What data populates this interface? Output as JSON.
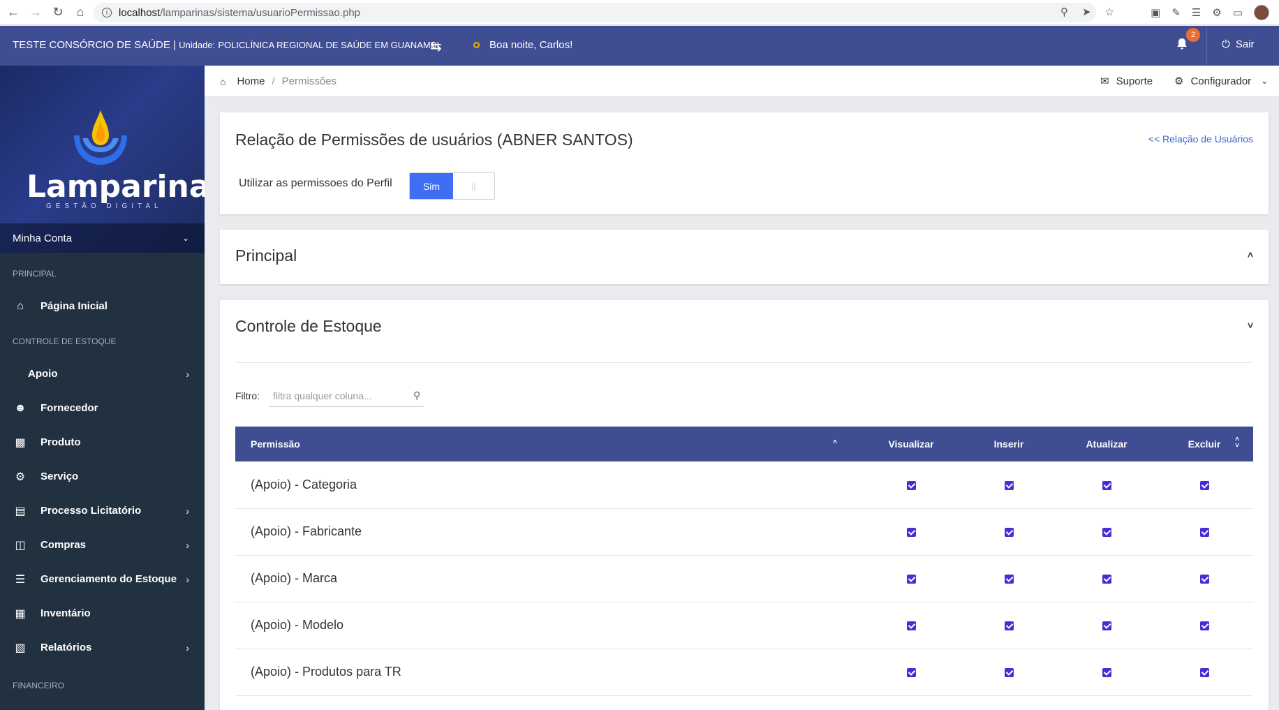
{
  "browser": {
    "url_host": "localhost",
    "url_path": "/lamparinas/sistema/usuarioPermissao.php"
  },
  "header": {
    "system_name": "TESTE CONSÓRCIO DE SAÚDE |",
    "unit_label": "Unidade:",
    "unit_value": "POLICLÍNICA REGIONAL DE SAÚDE EM GUANAMBI",
    "greeting": "Boa noite, Carlos!",
    "notification_count": "2",
    "logout_label": "Sair"
  },
  "sidebar": {
    "logo_text": "Lamparinas",
    "logo_subtitle": "GESTÃO DIGITAL",
    "account_label": "Minha Conta",
    "sections": [
      {
        "title": "PRINCIPAL",
        "items": [
          {
            "label": "Página Inicial",
            "icon": "home-icon",
            "has_submenu": false
          }
        ]
      },
      {
        "title": "CONTROLE DE ESTOQUE",
        "items": [
          {
            "label": "Apoio",
            "icon": "",
            "has_submenu": true
          },
          {
            "label": "Fornecedor",
            "icon": "user-icon",
            "has_submenu": false
          },
          {
            "label": "Produto",
            "icon": "gift-icon",
            "has_submenu": false
          },
          {
            "label": "Serviço",
            "icon": "gears-icon",
            "has_submenu": false
          },
          {
            "label": "Processo Licitatório",
            "icon": "document-icon",
            "has_submenu": true
          },
          {
            "label": "Compras",
            "icon": "bag-icon",
            "has_submenu": true
          },
          {
            "label": "Gerenciamento do Estoque",
            "icon": "layers-icon",
            "has_submenu": true
          },
          {
            "label": "Inventário",
            "icon": "clipboard-icon",
            "has_submenu": false
          },
          {
            "label": "Relatórios",
            "icon": "report-icon",
            "has_submenu": true
          }
        ]
      },
      {
        "title": "FINANCEIRO",
        "items": []
      }
    ]
  },
  "breadcrumb": {
    "home": "Home",
    "separator": "/",
    "current": "Permissões",
    "support_label": "Suporte",
    "config_label": "Configurador"
  },
  "main": {
    "title": "Relação de Permissões de usuários (ABNER SANTOS)",
    "back_link": "<< Relação de Usuários",
    "toggle_label": "Utilizar as permissoes do Perfil",
    "toggle_on_label": "Sim",
    "toggle_off_label": "||",
    "sections": [
      {
        "title": "Principal",
        "expanded": false
      },
      {
        "title": "Controle de Estoque",
        "expanded": true
      }
    ],
    "filter_label": "Filtro:",
    "filter_placeholder": "filtra qualquer coluna...",
    "table": {
      "columns": [
        "Permissão",
        "Visualizar",
        "Inserir",
        "Atualizar",
        "Excluir"
      ],
      "rows": [
        {
          "name": "(Apoio) - Categoria",
          "visualizar": true,
          "inserir": true,
          "atualizar": true,
          "excluir": true
        },
        {
          "name": "(Apoio) - Fabricante",
          "visualizar": true,
          "inserir": true,
          "atualizar": true,
          "excluir": true
        },
        {
          "name": "(Apoio) - Marca",
          "visualizar": true,
          "inserir": true,
          "atualizar": true,
          "excluir": true
        },
        {
          "name": "(Apoio) - Modelo",
          "visualizar": true,
          "inserir": true,
          "atualizar": true,
          "excluir": true
        },
        {
          "name": "(Apoio) - Produtos para TR",
          "visualizar": true,
          "inserir": true,
          "atualizar": true,
          "excluir": true
        }
      ]
    }
  },
  "colors": {
    "header_bg": "#3f4d93",
    "sidebar_bg": "#22313f",
    "toggle_on": "#3f6ef2",
    "checkbox": "#4a2bd6",
    "badge": "#f06b2f",
    "link": "#3a67c8"
  }
}
